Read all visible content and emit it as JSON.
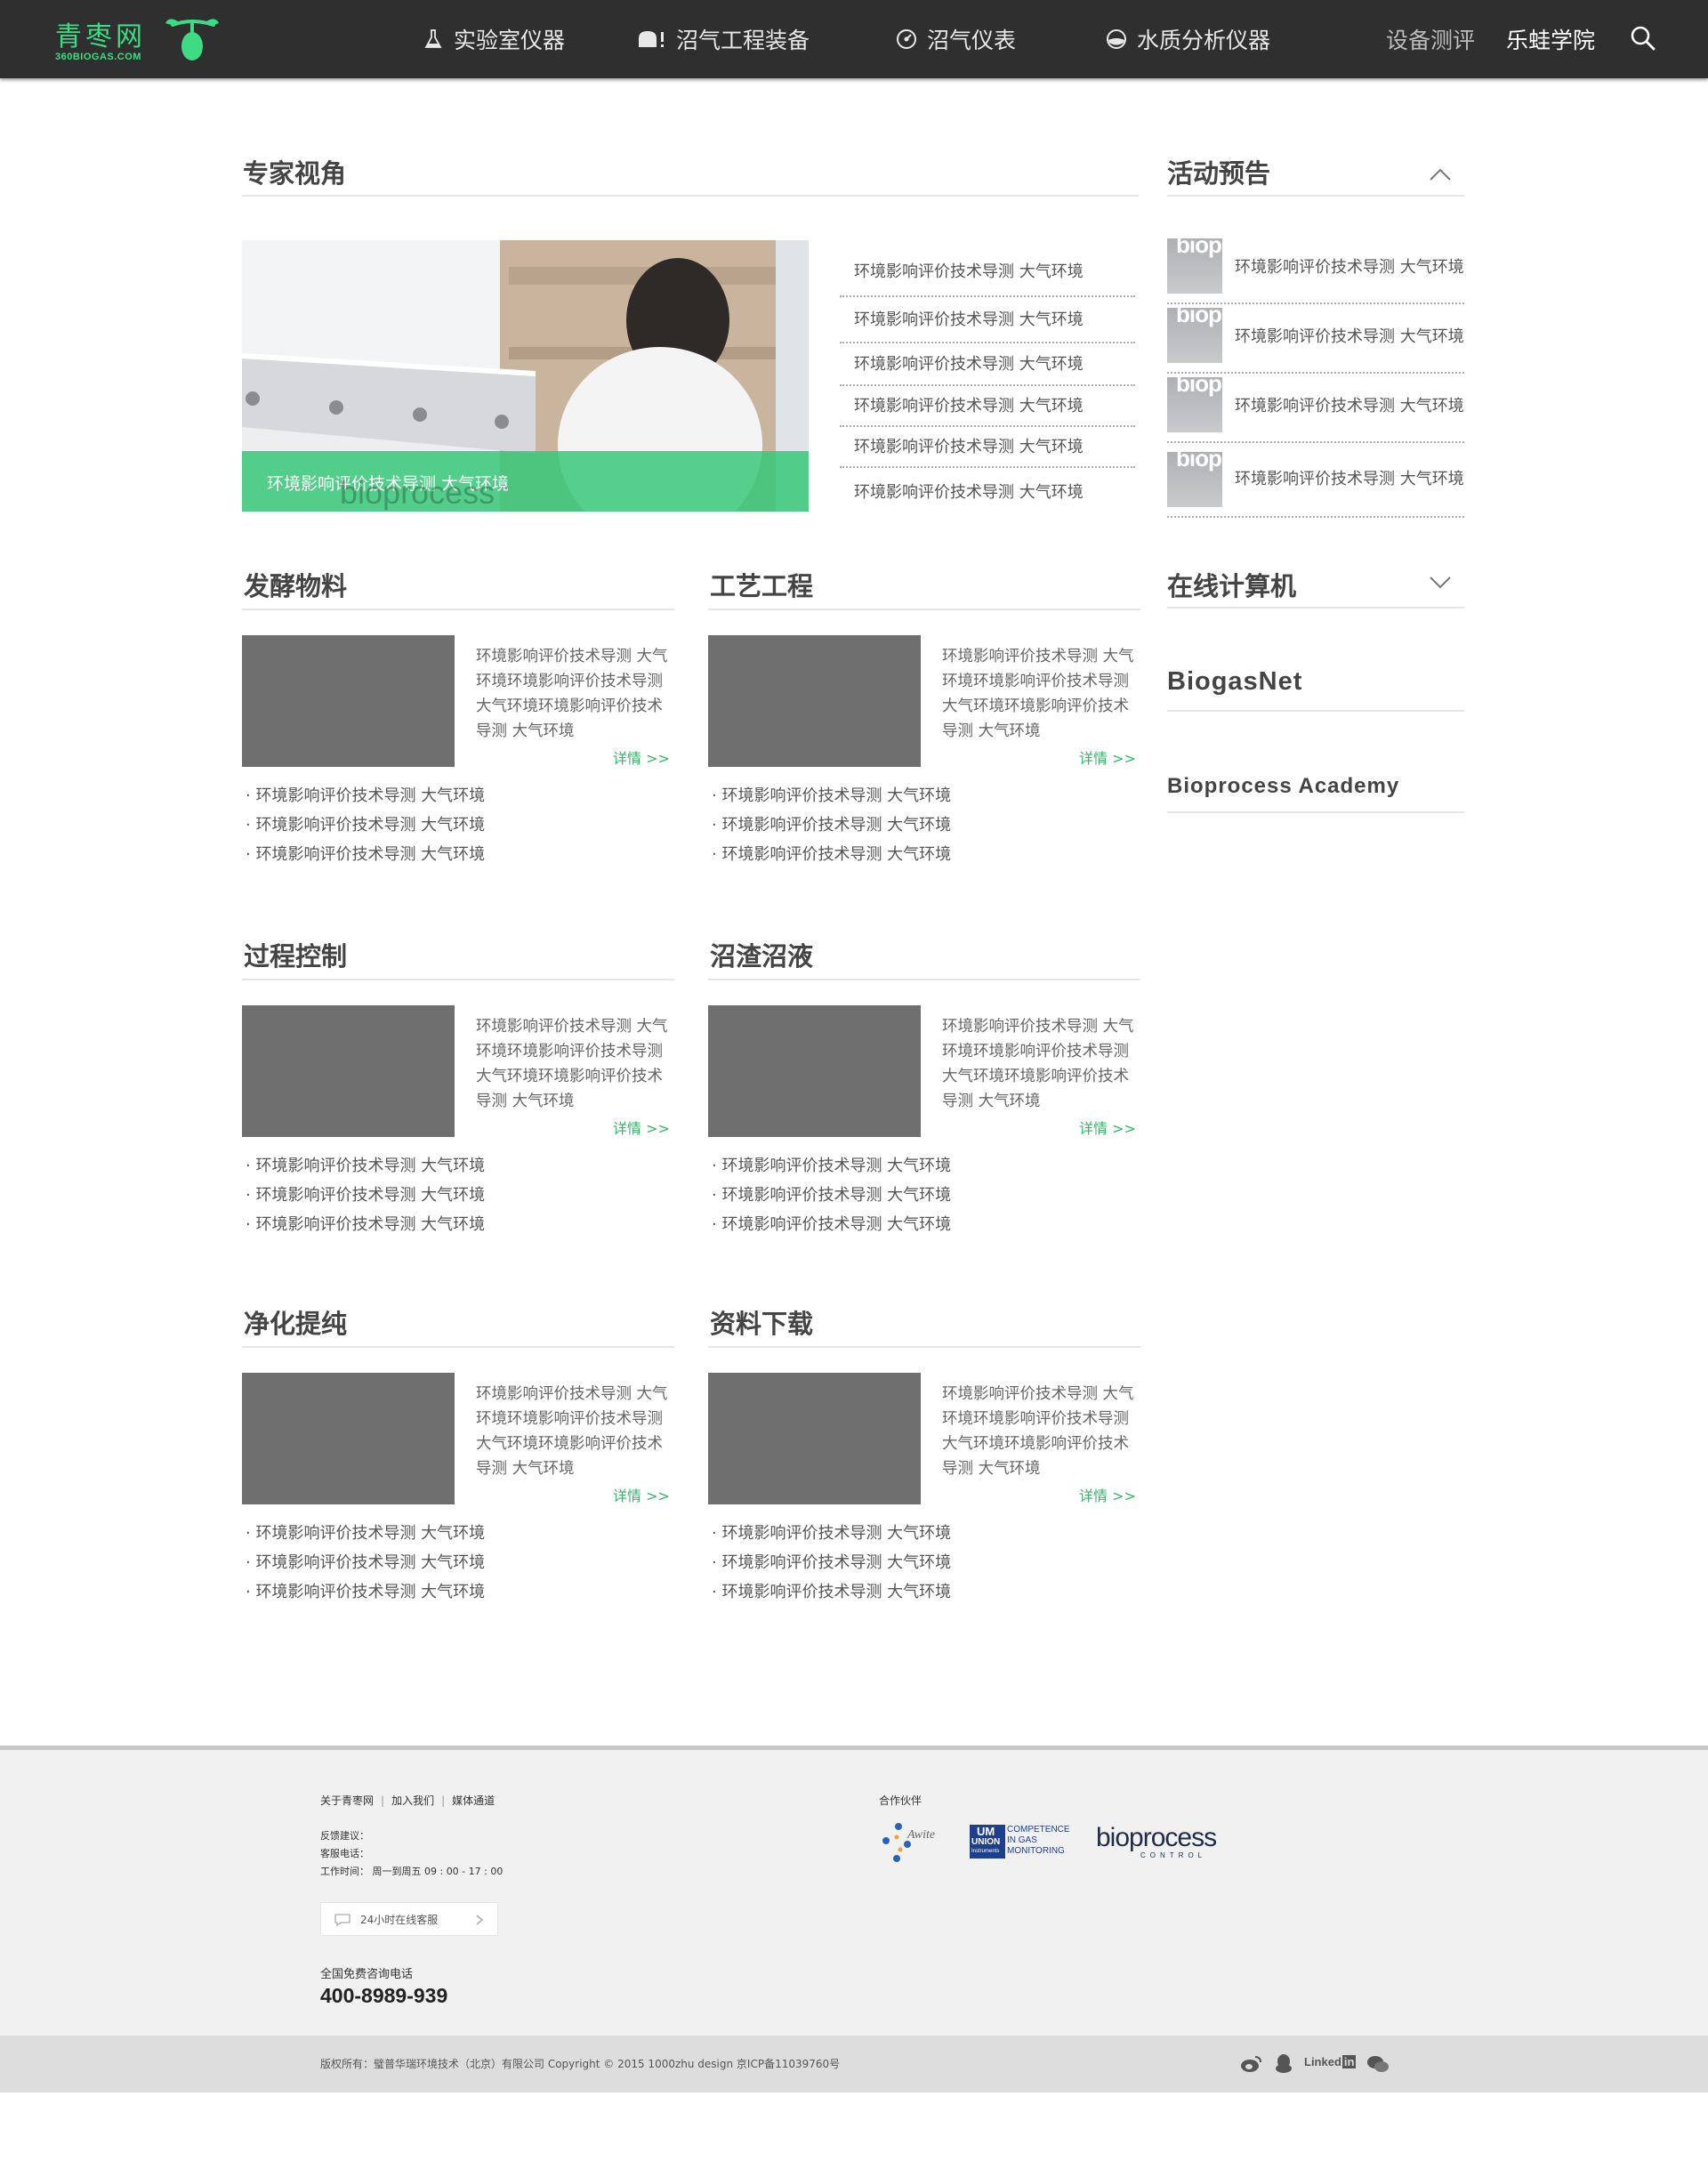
{
  "header": {
    "logo_cn": "青枣网",
    "logo_en": "360BIOGAS.COM",
    "nav": [
      {
        "label": "实验室仪器",
        "icon": "flask-icon"
      },
      {
        "label": "沼气工程装备",
        "icon": "tank-icon"
      },
      {
        "label": "沼气仪表",
        "icon": "gauge-icon"
      },
      {
        "label": "水质分析仪器",
        "icon": "water-drop-icon"
      }
    ],
    "review_label": "设备测评",
    "academy_label": "乐蛙学院",
    "search_icon": "search-icon"
  },
  "expert": {
    "title": "专家视角",
    "hero_caption": "环境影响评价技术导测 大气环境",
    "hero_watermark": "bioprocess",
    "list": [
      "环境影响评价技术导测 大气环境",
      "环境影响评价技术导测 大气环境",
      "环境影响评价技术导测 大气环境",
      "环境影响评价技术导测 大气环境",
      "环境影响评价技术导测 大气环境",
      "环境影响评价技术导测 大气环境"
    ]
  },
  "events": {
    "title": "活动预告",
    "thumb_text": "biop",
    "items": [
      "环境影响评价技术导测 大气环境",
      "环境影响评价技术导测 大气环境",
      "环境影响评价技术导测 大气环境",
      "环境影响评价技术导测 大气环境"
    ]
  },
  "calculator": {
    "title": "在线计算机",
    "links": [
      "BiogasNet",
      "Bioprocess Academy"
    ]
  },
  "categories": [
    {
      "title": "发酵物料",
      "summary": "环境影响评价技术导测 大气环境环境影响评价技术导测 大气环境环境影响评价技术导测 大气环境",
      "more": "详情 >>",
      "bullets": [
        "· 环境影响评价技术导测 大气环境",
        "· 环境影响评价技术导测 大气环境",
        "· 环境影响评价技术导测 大气环境"
      ]
    },
    {
      "title": "工艺工程",
      "summary": "环境影响评价技术导测 大气环境环境影响评价技术导测 大气环境环境影响评价技术导测 大气环境",
      "more": "详情 >>",
      "bullets": [
        "· 环境影响评价技术导测 大气环境",
        "· 环境影响评价技术导测 大气环境",
        "· 环境影响评价技术导测 大气环境"
      ]
    },
    {
      "title": "过程控制",
      "summary": "环境影响评价技术导测 大气环境环境影响评价技术导测 大气环境环境影响评价技术导测 大气环境",
      "more": "详情 >>",
      "bullets": [
        "· 环境影响评价技术导测 大气环境",
        "· 环境影响评价技术导测 大气环境",
        "· 环境影响评价技术导测 大气环境"
      ]
    },
    {
      "title": "沼渣沼液",
      "summary": "环境影响评价技术导测 大气环境环境影响评价技术导测 大气环境环境影响评价技术导测 大气环境",
      "more": "详情 >>",
      "bullets": [
        "· 环境影响评价技术导测 大气环境",
        "· 环境影响评价技术导测 大气环境",
        "· 环境影响评价技术导测 大气环境"
      ]
    },
    {
      "title": "净化提纯",
      "summary": "环境影响评价技术导测 大气环境环境影响评价技术导测 大气环境环境影响评价技术导测 大气环境",
      "more": "详情 >>",
      "bullets": [
        "· 环境影响评价技术导测 大气环境",
        "· 环境影响评价技术导测 大气环境",
        "· 环境影响评价技术导测 大气环境"
      ]
    },
    {
      "title": "资料下载",
      "summary": "环境影响评价技术导测 大气环境环境影响评价技术导测 大气环境环境影响评价技术导测 大气环境",
      "more": "详情 >>",
      "bullets": [
        "· 环境影响评价技术导测 大气环境",
        "· 环境影响评价技术导测 大气环境",
        "· 环境影响评价技术导测 大气环境"
      ]
    }
  ],
  "footer": {
    "links": [
      "关于青枣网",
      "加入我们",
      "媒体通道"
    ],
    "feedback_label": "反馈建议：",
    "service_phone_label": "客服电话：",
    "hours": "工作时间： 周一到周五 09 : 00 - 17 : 00",
    "chat_label": "24小时在线客服",
    "hotline_label": "全国免费咨询电话",
    "hotline": "400-8989-939",
    "partners_title": "合作伙伴",
    "partners": {
      "awite": "Awite",
      "union_top": "UM",
      "union_name": "UNION",
      "union_sub": "Instruments",
      "union_text": [
        "COMPETENCE",
        "IN GAS",
        "MONITORING"
      ],
      "bioprocess": "bioprocess",
      "bioprocess_sub": "CONTROL"
    },
    "copyright": "版权所有：璧普华瑞环境技术（北京）有限公司    Copyright © 2015 1000zhu design 京ICP备11039760号",
    "social": {
      "weibo_icon": "weibo-icon",
      "qq_icon": "qq-icon",
      "linkedin_label": "Linked",
      "linkedin_in": "in",
      "wechat_icon": "wechat-icon"
    }
  },
  "colors": {
    "header_bg": "#2f2f2f",
    "accent": "#3ddc84",
    "link_green": "#34b36a",
    "thumb": "#6f6f6f"
  }
}
